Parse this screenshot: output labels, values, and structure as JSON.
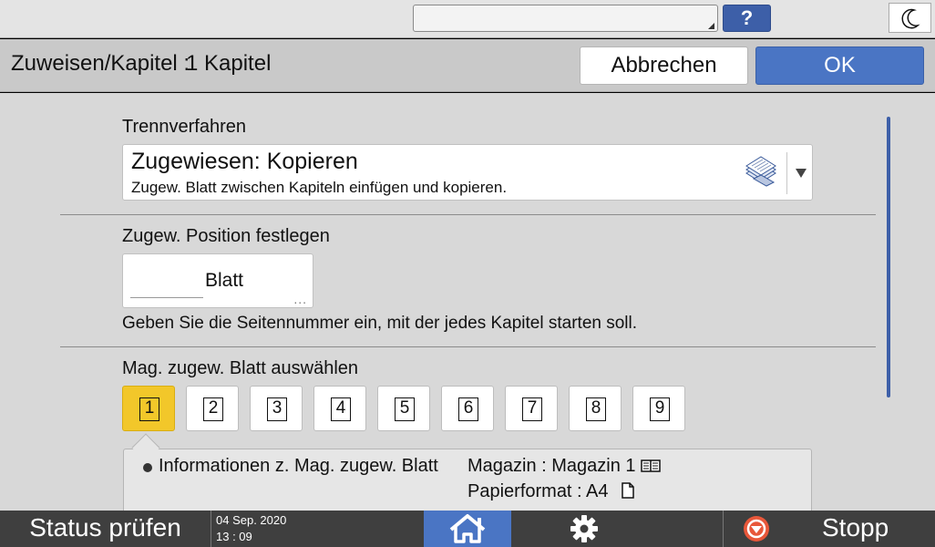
{
  "topbar": {
    "status_text": "",
    "help_label": "?",
    "sleep_icon": "moon-icon"
  },
  "header": {
    "title": "Zuweisen/Kapitel :",
    "value": "1 Kapitel",
    "cancel_label": "Abbrechen",
    "ok_label": "OK"
  },
  "separation": {
    "label": "Trennverfahren",
    "selected_title": "Zugewiesen: Kopieren",
    "selected_desc": "Zugew. Blatt zwischen Kapiteln einfügen und kopieren.",
    "icon": "copy-pages-icon"
  },
  "position": {
    "label": "Zugew. Position festlegen",
    "value": "",
    "unit": "Blatt",
    "more": "...",
    "hint": "Geben Sie die Seitennummer ein, mit der jedes Kapitel starten soll."
  },
  "trays": {
    "label": "Mag. zugew. Blatt auswählen",
    "items": [
      "1",
      "2",
      "3",
      "4",
      "5",
      "6",
      "7",
      "8",
      "9"
    ],
    "selected": "1"
  },
  "info": {
    "title": "Informationen z. Mag. zugew. Blatt",
    "tray_line": "Magazin : Magazin 1",
    "format_line": "Papierformat : A4"
  },
  "bottombar": {
    "status_label": "Status prüfen",
    "date": "04 Sep. 2020",
    "time": "13 : 09",
    "stop_label": "Stopp"
  },
  "colors": {
    "accent": "#4a75c4",
    "selected_tray": "#f2c72a",
    "help": "#3d5fa8",
    "stop_icon": "#e8573a"
  }
}
